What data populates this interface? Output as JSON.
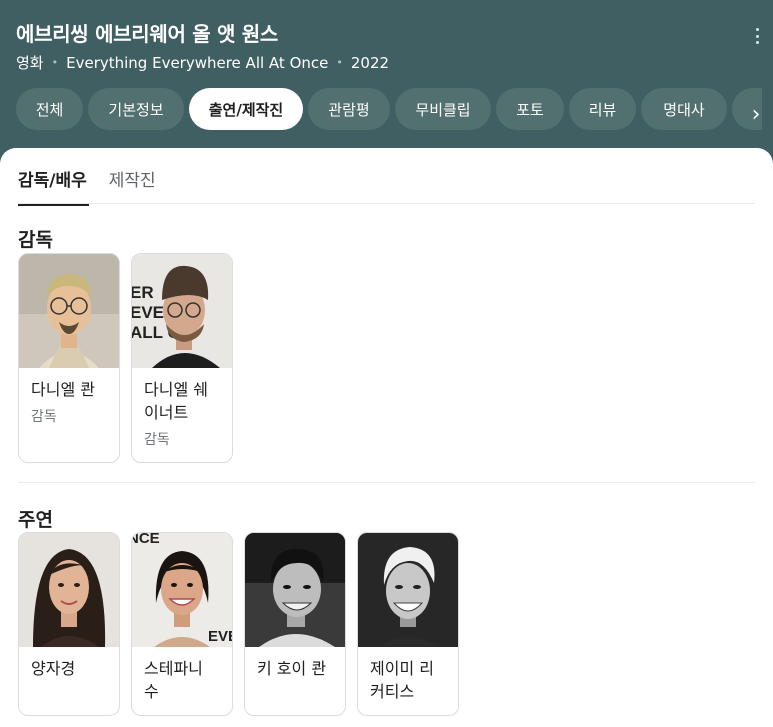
{
  "header": {
    "title": "에브리씽 에브리웨어 올 앳 원스",
    "genre": "영화",
    "original_title": "Everything Everywhere All At Once",
    "year": "2022",
    "background_color": "#3f5f62",
    "more_icon": "more-vert-icon",
    "next_icon": "chevron-right-icon"
  },
  "tabs": [
    {
      "label": "전체"
    },
    {
      "label": "기본정보"
    },
    {
      "label": "출연/제작진",
      "active": true
    },
    {
      "label": "관람평"
    },
    {
      "label": "무비클립"
    },
    {
      "label": "포토"
    },
    {
      "label": "리뷰"
    },
    {
      "label": "명대사"
    }
  ],
  "subtabs": [
    {
      "label": "감독/배우",
      "active": true
    },
    {
      "label": "제작진"
    }
  ],
  "sections": {
    "directors": {
      "title": "감독",
      "people": [
        {
          "name": "다니엘 콴",
          "role": "감독"
        },
        {
          "name": "다니엘 쉐이너트",
          "role": "감독"
        }
      ]
    },
    "cast": {
      "title": "주연",
      "people": [
        {
          "name": "양자경"
        },
        {
          "name": "스테파니 수"
        },
        {
          "name": "키 호이 콴"
        },
        {
          "name": "제이미 리 커티스"
        }
      ]
    }
  }
}
